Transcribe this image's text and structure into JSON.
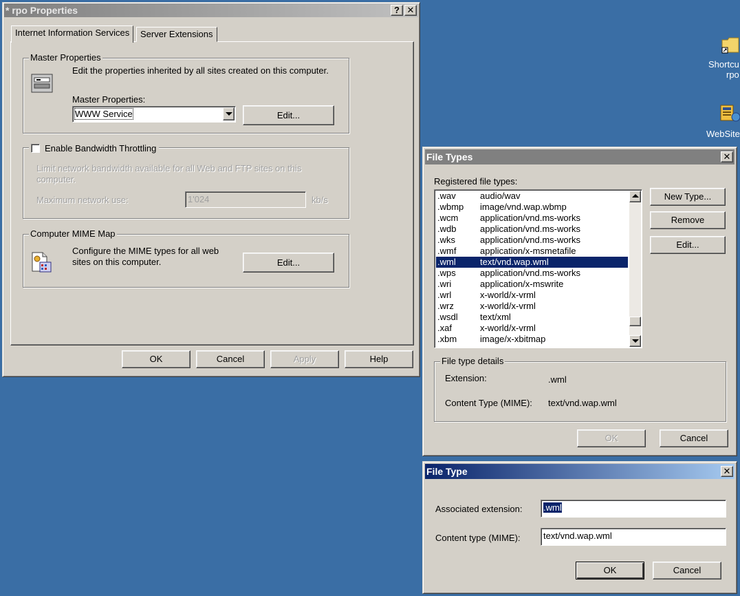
{
  "desktop": {
    "icons": [
      {
        "name": "folder-shortcut-icon",
        "label_line1": "Shortcu",
        "label_line2": "rpo"
      },
      {
        "name": "website-icon",
        "label_line1": "WebSite"
      }
    ]
  },
  "properties_window": {
    "title": "* rpo Properties",
    "help_glyph": "?",
    "close_glyph": "✕",
    "tabs": [
      "Internet Information Services",
      "Server Extensions"
    ],
    "master": {
      "group_label": "Master Properties",
      "description": "Edit the properties inherited by all sites created on this computer.",
      "field_label": "Master Properties:",
      "selected": "WWW Service",
      "edit_label": "Edit..."
    },
    "bandwidth": {
      "checkbox_label": "Enable Bandwidth Throttling",
      "checked": false,
      "description_line1": "Limit network bandwidth available for all Web and FTP sites on this",
      "description_line2": "computer.",
      "max_label": "Maximum network use:",
      "max_value": "1'024",
      "unit": "kb/s"
    },
    "mime": {
      "group_label": "Computer MIME Map",
      "description_line1": "Configure the MIME types for all web",
      "description_line2": "sites on this computer.",
      "edit_label": "Edit..."
    },
    "buttons": {
      "ok": "OK",
      "cancel": "Cancel",
      "apply": "Apply",
      "help": "Help"
    }
  },
  "file_types_window": {
    "title": "File Types",
    "close_glyph": "✕",
    "list_label": "Registered file types:",
    "rows": [
      {
        "ext": ".wav",
        "mime": "audio/wav"
      },
      {
        "ext": ".wbmp",
        "mime": "image/vnd.wap.wbmp"
      },
      {
        "ext": ".wcm",
        "mime": "application/vnd.ms-works"
      },
      {
        "ext": ".wdb",
        "mime": "application/vnd.ms-works"
      },
      {
        "ext": ".wks",
        "mime": "application/vnd.ms-works"
      },
      {
        "ext": ".wmf",
        "mime": "application/x-msmetafile"
      },
      {
        "ext": ".wml",
        "mime": "text/vnd.wap.wml"
      },
      {
        "ext": ".wps",
        "mime": "application/vnd.ms-works"
      },
      {
        "ext": ".wri",
        "mime": "application/x-mswrite"
      },
      {
        "ext": ".wrl",
        "mime": "x-world/x-vrml"
      },
      {
        "ext": ".wrz",
        "mime": "x-world/x-vrml"
      },
      {
        "ext": ".wsdl",
        "mime": "text/xml"
      },
      {
        "ext": ".xaf",
        "mime": "x-world/x-vrml"
      },
      {
        "ext": ".xbm",
        "mime": "image/x-xbitmap"
      }
    ],
    "selected_index": 6,
    "buttons": {
      "new_type": "New Type...",
      "remove": "Remove",
      "edit": "Edit...",
      "ok": "OK",
      "cancel": "Cancel"
    },
    "details": {
      "group_label": "File type details",
      "extension_label": "Extension:",
      "extension_value": ".wml",
      "content_type_label": "Content Type (MIME):",
      "content_type_value": "text/vnd.wap.wml"
    }
  },
  "file_type_window": {
    "title": "File Type",
    "close_glyph": "✕",
    "assoc_label": "Associated extension:",
    "assoc_value": ".wml",
    "content_label": "Content type (MIME):",
    "content_value": "text/vnd.wap.wml",
    "buttons": {
      "ok": "OK",
      "cancel": "Cancel"
    }
  },
  "colors": {
    "desktop": "#3a6ea5",
    "selection": "#0a246a",
    "face": "#d4d0c8"
  }
}
